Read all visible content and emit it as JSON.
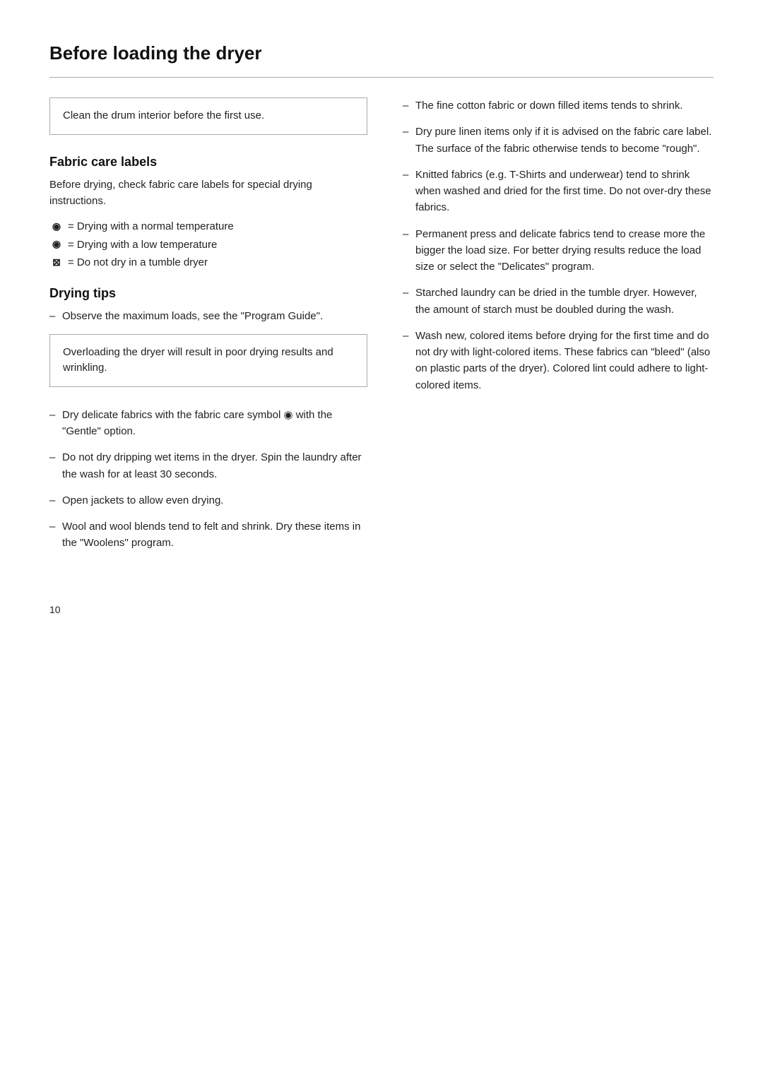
{
  "page": {
    "title": "Before loading the dryer",
    "page_number": "10"
  },
  "note_box": {
    "text": "Clean the drum interior before the first use."
  },
  "fabric_care": {
    "heading": "Fabric care labels",
    "intro": "Before drying, check fabric care labels for special drying instructions.",
    "symbols": [
      {
        "icon": "⊙",
        "text": "= Drying with a normal temperature",
        "type": "normal"
      },
      {
        "icon": "⊙",
        "text": "= Drying with a low temperature",
        "type": "low"
      },
      {
        "icon": "⊠",
        "text": "= Do not dry in a tumble dryer",
        "type": "no"
      }
    ]
  },
  "drying_tips": {
    "heading": "Drying tips",
    "items": [
      {
        "text": "Observe the maximum loads, see the \"Program Guide\"."
      }
    ],
    "warning_box": "Overloading the dryer will result in poor drying results and wrinkling.",
    "more_items": [
      {
        "text": "Dry delicate fabrics with the fabric care symbol ⊙ with the \"Gentle\" option."
      },
      {
        "text": "Do not dry dripping wet items in the dryer. Spin the laundry after the wash for at least 30 seconds."
      },
      {
        "text": "Open jackets to allow even drying."
      },
      {
        "text": "Wool and wool blends tend to felt and shrink. Dry these items in the \"Woolens\" program."
      }
    ]
  },
  "right_col": {
    "items": [
      {
        "text": "The fine cotton fabric or down filled items tends to shrink."
      },
      {
        "text": "Dry pure linen items only if it is advised on the fabric care label. The surface of the fabric otherwise tends to become \"rough\"."
      },
      {
        "text": "Knitted fabrics (e.g. T-Shirts and underwear)  tend to shrink when washed and dried for the first time. Do not over-dry these fabrics."
      },
      {
        "text": "Permanent press and delicate fabrics tend to crease more the bigger the load size. For better drying results reduce the load size or select the \"Delicates\" program."
      },
      {
        "text": "Starched laundry can be dried in the tumble dryer. However, the amount of starch must be doubled during the wash."
      },
      {
        "text": "Wash new, colored items before drying for the first time and do not dry with light-colored items. These fabrics can \"bleed\" (also on plastic parts of the dryer). Colored lint could adhere to light-colored items."
      }
    ]
  }
}
